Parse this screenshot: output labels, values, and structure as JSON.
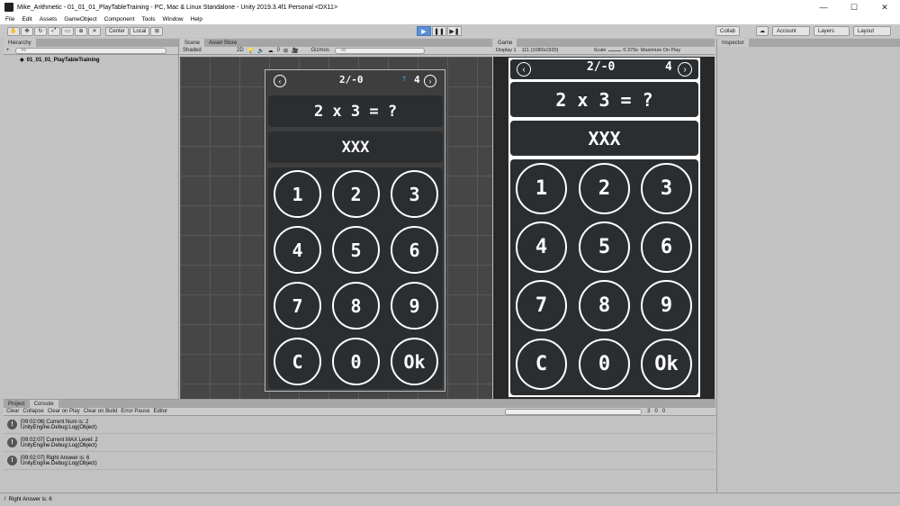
{
  "window": {
    "title": "Mike_Arithmetic - 01_01_01_PlayTableTraining - PC, Mac & Linux Standalone - Unity 2019.3.4f1 Personal <DX11>",
    "minimize": "—",
    "maximize": "☐",
    "close": "✕"
  },
  "menu": [
    "File",
    "Edit",
    "Assets",
    "GameObject",
    "Component",
    "Tools",
    "Window",
    "Help"
  ],
  "toolbar": {
    "pivot": "Center",
    "space": "Local",
    "play": "▶",
    "pause": "❚❚",
    "step": "▶❚",
    "collab": "Collab",
    "account": "Account",
    "layers": "Layers",
    "layout": "Layout"
  },
  "hierarchy": {
    "tab": "Hierarchy",
    "add": "+",
    "search_placeholder": "All",
    "scene_item": "01_01_01_PlayTableTraining"
  },
  "scene": {
    "tab": "Scene",
    "asset_tab": "Asset Store",
    "shading": "Shaded",
    "mode2d": "2D",
    "gizmos": "Gizmos",
    "search_placeholder": "All",
    "layer_count": "0"
  },
  "game": {
    "tab": "Game",
    "display": "Display 1",
    "resolution": "111 (1080x1920)",
    "scale_label": "Scale",
    "scale_value": "0.379x",
    "maximize": "Maximize On Play"
  },
  "inspector": {
    "tab": "Inspector"
  },
  "app": {
    "progress": "2/-0",
    "level": "4",
    "level_tag": "T",
    "question": "2 x 3 = ?",
    "answer": "XXX",
    "keys": [
      "1",
      "2",
      "3",
      "4",
      "5",
      "6",
      "7",
      "8",
      "9",
      "C",
      "0",
      "Ok"
    ],
    "prev": "‹",
    "next": "›"
  },
  "console": {
    "project_tab": "Project",
    "console_tab": "Console",
    "clear": "Clear",
    "collapse": "Collapse",
    "clear_on_play": "Clear on Play",
    "clear_on_build": "Clear on Build",
    "error_pause": "Error Pause",
    "editor": "Editor",
    "info_count": "3",
    "warn_count": "0",
    "error_count": "0",
    "entries": [
      {
        "line1": "[09:02:06] Current Num is: 2",
        "line2": "UnityEngine.Debug:Log(Object)"
      },
      {
        "line1": "[09:02:07] Current MAX Level: 2",
        "line2": "UnityEngine.Debug:Log(Object)"
      },
      {
        "line1": "[09:02:07] Right Answer is: 6",
        "line2": "UnityEngine.Debug:Log(Object)"
      }
    ]
  },
  "status": {
    "text": "Right Answer is: 6"
  }
}
